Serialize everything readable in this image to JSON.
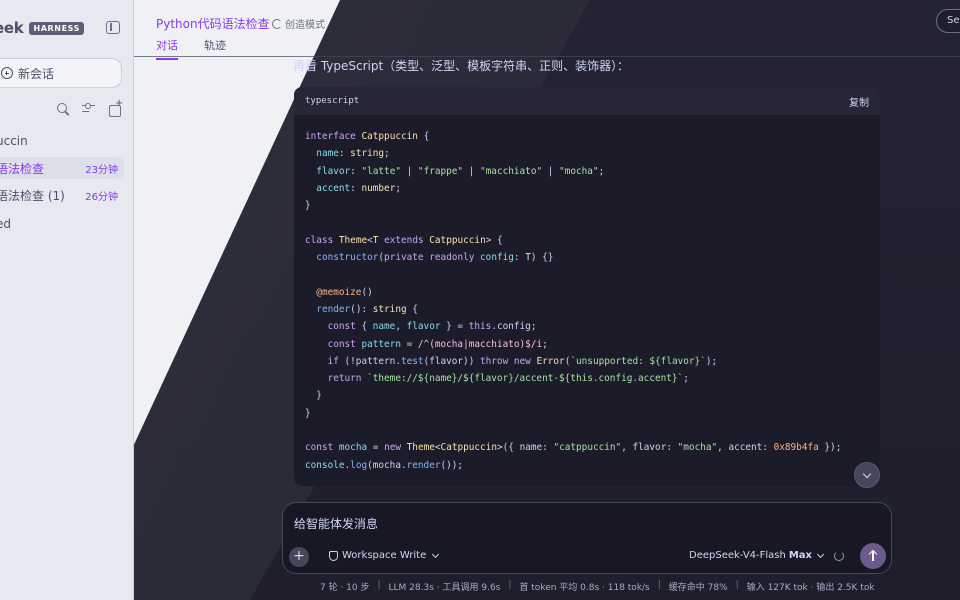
{
  "app": {
    "brand_name": "eek",
    "brand_badge": "HARNESS"
  },
  "sidebar": {
    "new_chat_label": "新会话",
    "items": [
      {
        "label": "uccin",
        "time": ""
      },
      {
        "label": "语法检查",
        "time": "23分钟"
      },
      {
        "label": "语法检查 (1)",
        "time": "26分钟"
      },
      {
        "label": "ed",
        "time": ""
      }
    ]
  },
  "header": {
    "title": "Python代码语法检查",
    "mode": "创造模式",
    "tabs": [
      "对话",
      "轨迹"
    ],
    "session_label": "Se"
  },
  "chat": {
    "message_line": "再看 TypeScript（类型、泛型、模板字符串、正则、装饰器）：",
    "code_lang": "typescript",
    "copy_label": "复制",
    "code_lines": [
      [
        [
          "kw",
          "interface"
        ],
        [
          "pl",
          " "
        ],
        [
          "ty",
          "Catppuccin"
        ],
        [
          "pl",
          " {"
        ]
      ],
      [
        [
          "pl",
          "  "
        ],
        [
          "prop",
          "name"
        ],
        [
          "pl",
          ": "
        ],
        [
          "ty",
          "string"
        ],
        [
          "pl",
          ";"
        ]
      ],
      [
        [
          "pl",
          "  "
        ],
        [
          "prop",
          "flavor"
        ],
        [
          "pl",
          ": "
        ],
        [
          "str",
          "\"latte\""
        ],
        [
          "pl",
          " | "
        ],
        [
          "str",
          "\"frappe\""
        ],
        [
          "pl",
          " | "
        ],
        [
          "str",
          "\"macchiato\""
        ],
        [
          "pl",
          " | "
        ],
        [
          "str",
          "\"mocha\""
        ],
        [
          "pl",
          ";"
        ]
      ],
      [
        [
          "pl",
          "  "
        ],
        [
          "prop",
          "accent"
        ],
        [
          "pl",
          ": "
        ],
        [
          "ty",
          "number"
        ],
        [
          "pl",
          ";"
        ]
      ],
      [
        [
          "pl",
          "}"
        ]
      ],
      [
        [
          "pl",
          ""
        ]
      ],
      [
        [
          "kw",
          "class"
        ],
        [
          "pl",
          " "
        ],
        [
          "ty",
          "Theme"
        ],
        [
          "pl",
          "<"
        ],
        [
          "ty",
          "T"
        ],
        [
          "pl",
          " "
        ],
        [
          "kw",
          "extends"
        ],
        [
          "pl",
          " "
        ],
        [
          "ty",
          "Catppuccin"
        ],
        [
          "pl",
          "> {"
        ]
      ],
      [
        [
          "pl",
          "  "
        ],
        [
          "fn",
          "constructor"
        ],
        [
          "pl",
          "("
        ],
        [
          "kw",
          "private"
        ],
        [
          "pl",
          " "
        ],
        [
          "kw",
          "readonly"
        ],
        [
          "pl",
          " "
        ],
        [
          "prop",
          "config"
        ],
        [
          "pl",
          ": "
        ],
        [
          "ty",
          "T"
        ],
        [
          "pl",
          ") {}"
        ]
      ],
      [
        [
          "pl",
          ""
        ]
      ],
      [
        [
          "pl",
          "  "
        ],
        [
          "dec",
          "@memoize"
        ],
        [
          "pl",
          "()"
        ]
      ],
      [
        [
          "pl",
          "  "
        ],
        [
          "fn",
          "render"
        ],
        [
          "pl",
          "(): "
        ],
        [
          "ty",
          "string"
        ],
        [
          "pl",
          " {"
        ]
      ],
      [
        [
          "pl",
          "    "
        ],
        [
          "kw",
          "const"
        ],
        [
          "pl",
          " { "
        ],
        [
          "prop",
          "name"
        ],
        [
          "pl",
          ", "
        ],
        [
          "prop",
          "flavor"
        ],
        [
          "pl",
          " } = "
        ],
        [
          "kw",
          "this"
        ],
        [
          "pl",
          ".config;"
        ]
      ],
      [
        [
          "pl",
          "    "
        ],
        [
          "kw",
          "const"
        ],
        [
          "pl",
          " "
        ],
        [
          "prop",
          "pattern"
        ],
        [
          "pl",
          " = "
        ],
        [
          "re",
          "/^(mocha|macchiato)$/i"
        ],
        [
          "pl",
          ";"
        ]
      ],
      [
        [
          "pl",
          "    "
        ],
        [
          "kw",
          "if"
        ],
        [
          "pl",
          " (!pattern."
        ],
        [
          "fn",
          "test"
        ],
        [
          "pl",
          "(flavor)) "
        ],
        [
          "kw",
          "throw"
        ],
        [
          "pl",
          " "
        ],
        [
          "kw",
          "new"
        ],
        [
          "pl",
          " "
        ],
        [
          "ty",
          "Error"
        ],
        [
          "pl",
          "("
        ],
        [
          "str",
          "`unsupported: ${flavor}`"
        ],
        [
          "pl",
          ");"
        ]
      ],
      [
        [
          "pl",
          "    "
        ],
        [
          "kw",
          "return"
        ],
        [
          "pl",
          " "
        ],
        [
          "str",
          "`theme://${name}/${flavor}/accent-${this.config.accent}`"
        ],
        [
          "pl",
          ";"
        ]
      ],
      [
        [
          "pl",
          "  }"
        ]
      ],
      [
        [
          "pl",
          "}"
        ]
      ],
      [
        [
          "pl",
          ""
        ]
      ],
      [
        [
          "kw",
          "const"
        ],
        [
          "pl",
          " "
        ],
        [
          "prop",
          "mocha"
        ],
        [
          "pl",
          " = "
        ],
        [
          "kw",
          "new"
        ],
        [
          "pl",
          " "
        ],
        [
          "ty",
          "Theme"
        ],
        [
          "pl",
          "<"
        ],
        [
          "ty",
          "Catppuccin"
        ],
        [
          "pl",
          ">({ name: "
        ],
        [
          "str",
          "\"catppuccin\""
        ],
        [
          "pl",
          ", flavor: "
        ],
        [
          "str",
          "\"mocha\""
        ],
        [
          "pl",
          ", accent: "
        ],
        [
          "num",
          "0x89b4fa"
        ],
        [
          "pl",
          " });"
        ]
      ],
      [
        [
          "prop",
          "console"
        ],
        [
          "pl",
          "."
        ],
        [
          "fn",
          "log"
        ],
        [
          "pl",
          "(mocha."
        ],
        [
          "fn",
          "render"
        ],
        [
          "pl",
          "());"
        ]
      ]
    ]
  },
  "composer": {
    "placeholder": "给智能体发消息",
    "workspace_label": "Workspace Write",
    "model_name": "DeepSeek-V4-Flash",
    "model_tier": "Max"
  },
  "status": [
    "7 轮 · 10 步",
    "LLM 28.3s · 工具调用 9.6s",
    "首 token 平均 0.8s · 118 tok/s",
    "缓存命中 78%",
    "输入 127K tok · 输出 2.5K tok"
  ],
  "colors": {
    "accent": "#8839ef",
    "code_bg": "#1b1b29",
    "page_dark": "#1e1e2e",
    "sidebar_bg": "#e6e9ef"
  },
  "icons": [
    "sidebar-toggle-icon",
    "plus-circle-icon",
    "search-icon",
    "sliders-icon",
    "compose-icon",
    "recycle-icon",
    "shield-icon",
    "chevron-down-icon",
    "spinner-icon",
    "arrow-up-icon"
  ]
}
